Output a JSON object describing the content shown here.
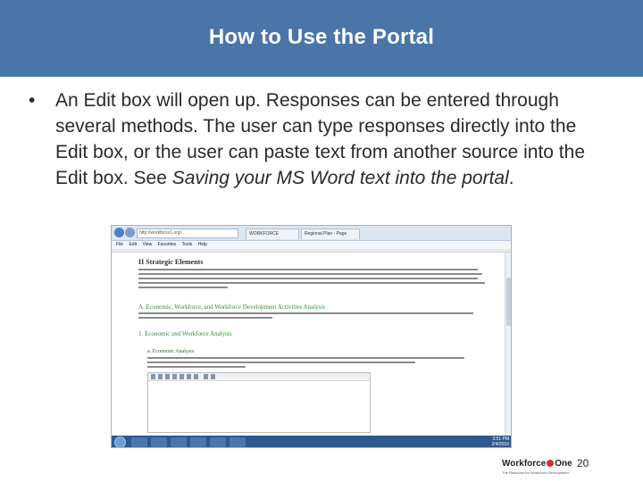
{
  "slide": {
    "title": "How to Use the Portal",
    "bullet_symbol": "•",
    "bullet_text": "An Edit box will open up. Responses can be entered through several methods.  The user can type responses directly into the Edit box, or the user can paste text from another source into the Edit box. See ",
    "bullet_link": "Saving your MS Word text into the portal",
    "bullet_end": ".",
    "page_number": "20"
  },
  "screenshot": {
    "browser": {
      "url": "http://workforce1.org/...",
      "tabs": [
        "WORKFORCE",
        "Regional Plan - Page"
      ],
      "menu": [
        "File",
        "Edit",
        "View",
        "Favorites",
        "Tools",
        "Help"
      ]
    },
    "document": {
      "section_heading": "II Strategic Elements",
      "subheading_a": "A. Economic, Workforce, and Workforce Development Activities Analysis",
      "subheading_1": "1. Economic and Workforce Analysis",
      "subheading_a_item": "a. Economic Analysis"
    },
    "taskbar": {
      "time": "3:51 PM",
      "date": "2/4/2016"
    }
  },
  "footer": {
    "logo_part1": "Workforce",
    "logo_part2": "One",
    "logo_tagline": "The Resource for Workforce Development"
  },
  "colors": {
    "title_band": "#4a75a8",
    "title_text": "#ffffff",
    "body_text": "#2a2a2a",
    "heading_green": "#3a8a3a",
    "taskbar": "#2d5a8c"
  }
}
